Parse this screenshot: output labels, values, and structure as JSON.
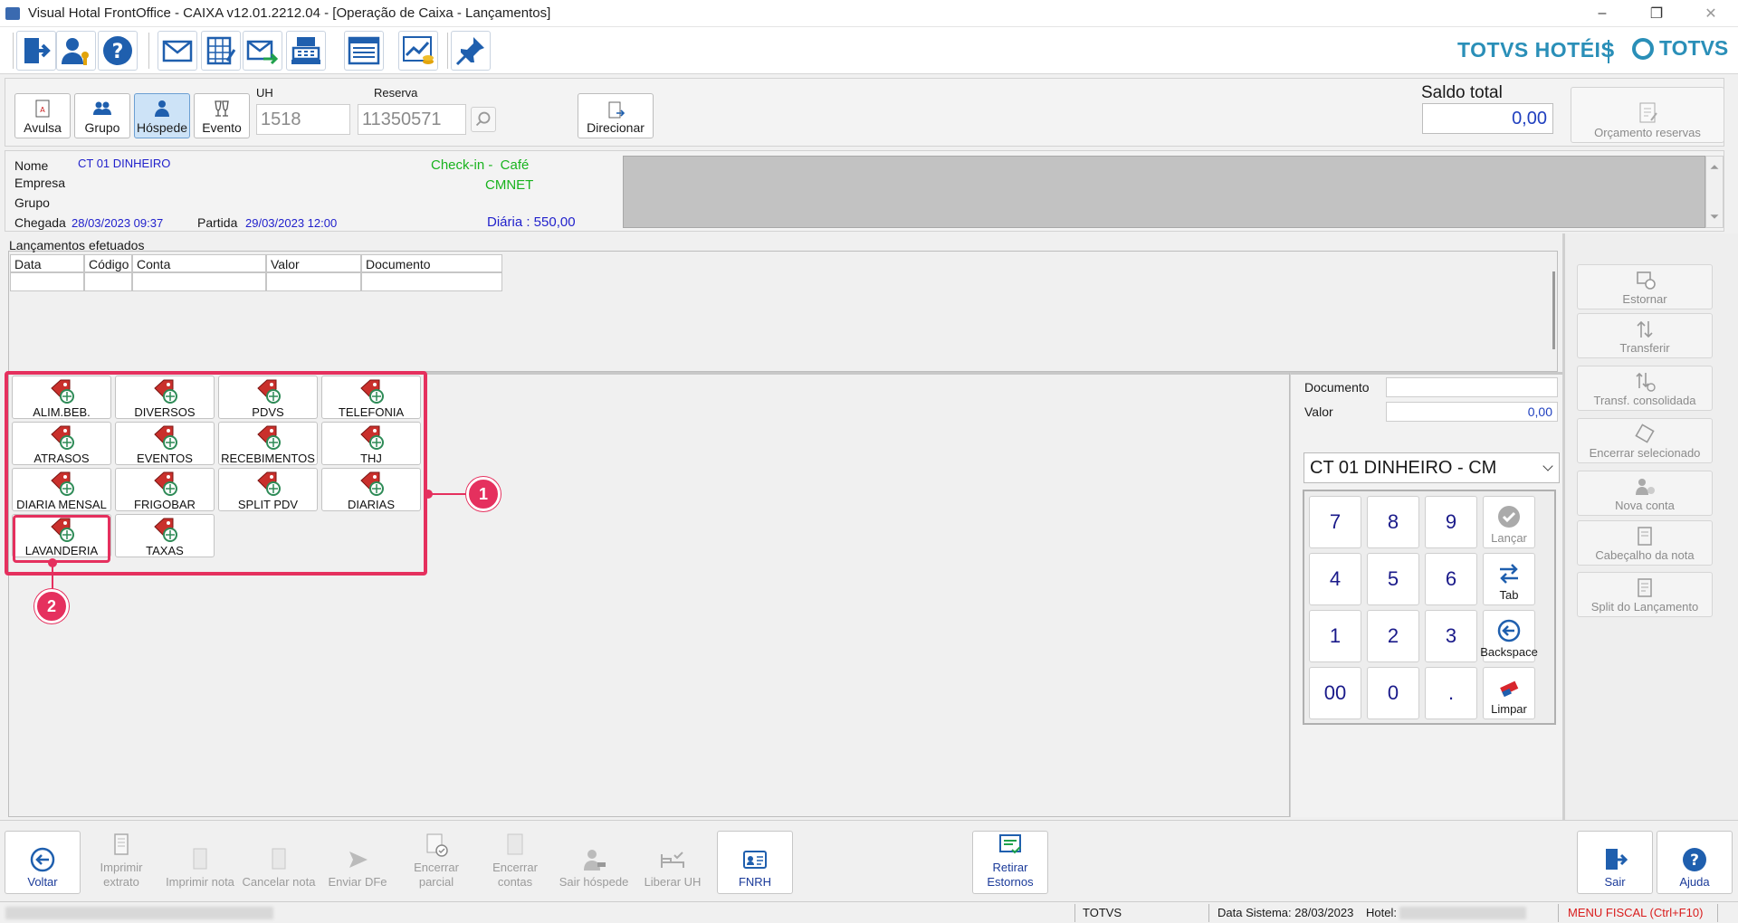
{
  "window": {
    "title": "Visual Hotal FrontOffice - CAIXA v12.01.2212.04 - [Operação de Caixa - Lançamentos]",
    "minimize": "–",
    "restore": "❐",
    "close": "✕"
  },
  "brand": {
    "left": "TOTVS HOTÉIS",
    "right": "TOTVS"
  },
  "header": {
    "types": [
      "Avulsa",
      "Grupo",
      "Hóspede",
      "Evento"
    ],
    "uh_label": "UH",
    "uh_value": "1518",
    "reserva_label": "Reserva",
    "reserva_value": "11350571",
    "direcionar_label": "Direcionar",
    "saldo_label": "Saldo total",
    "saldo_value": "0,00",
    "orcamento_label": "Orçamento reservas"
  },
  "guest": {
    "nome_label": "Nome",
    "nome_value": "CT 01 DINHEIRO",
    "empresa_label": "Empresa",
    "grupo_label": "Grupo",
    "chegada_label": "Chegada",
    "chegada_value": "28/03/2023 09:37",
    "partida_label": "Partida",
    "partida_value": "29/03/2023 12:00",
    "checkin_text": "Check-in -  Café",
    "cmnet_text": "CMNET",
    "diaria_text": "Diária : 550,00"
  },
  "lancamentos": {
    "title": "Lançamentos efetuados",
    "columns": [
      "Data",
      "Código",
      "Conta",
      "Valor",
      "Documento"
    ]
  },
  "right_actions": [
    "Estornar",
    "Transferir",
    "Transf. consolidada",
    "Encerrar selecionado",
    "Nova conta",
    "Cabeçalho da nota",
    "Split do Lançamento"
  ],
  "categories": [
    "ALIM.BEB.",
    "DIVERSOS",
    "PDVS",
    "TELEFONIA",
    "ATRASOS",
    "EVENTOS",
    "RECEBIMENTOS",
    "THJ",
    "DIARIA MENSAL",
    "FRIGOBAR",
    "SPLIT PDV",
    "DIARIAS",
    "LAVANDERIA",
    "TAXAS"
  ],
  "annotations": {
    "badge1": "1",
    "badge2": "2"
  },
  "payment": {
    "documento_label": "Documento",
    "documento_value": "",
    "valor_label": "Valor",
    "valor_value": "0,00",
    "account_selected": "CT 01 DINHEIRO - CM",
    "keys": [
      "7",
      "8",
      "9",
      "4",
      "5",
      "6",
      "1",
      "2",
      "3",
      "00",
      "0",
      "."
    ],
    "fn_keys": [
      "Lançar",
      "Tab",
      "Backspace",
      "Limpar"
    ]
  },
  "bottom": [
    "Voltar",
    "Imprimir extrato",
    "Imprimir nota",
    "Cancelar nota",
    "Enviar DFe",
    "Encerrar parcial",
    "Encerrar contas",
    "Sair hóspede",
    "Liberar UH",
    "FNRH",
    "Retirar Estornos",
    "Sair",
    "Ajuda"
  ],
  "status": {
    "totvs": "TOTVS",
    "data_sistema": "Data Sistema: 28/03/2023",
    "hotel_label": "Hotel:",
    "menu_fiscal": "MENU FISCAL (Ctrl+F10)"
  },
  "colors": {
    "accent": "#2a8fb8",
    "annotation": "#e5305e",
    "value_blue": "#2222cc",
    "status_green": "#19b31e",
    "menu_fiscal_red": "#d91c1c"
  },
  "icons": [
    "exit-door-icon",
    "user-key-icon",
    "help-icon",
    "mail-icon",
    "calculator-grid-icon",
    "mail-send-icon",
    "cash-register-icon",
    "list-icon",
    "chart-coins-icon",
    "pin-icon"
  ]
}
